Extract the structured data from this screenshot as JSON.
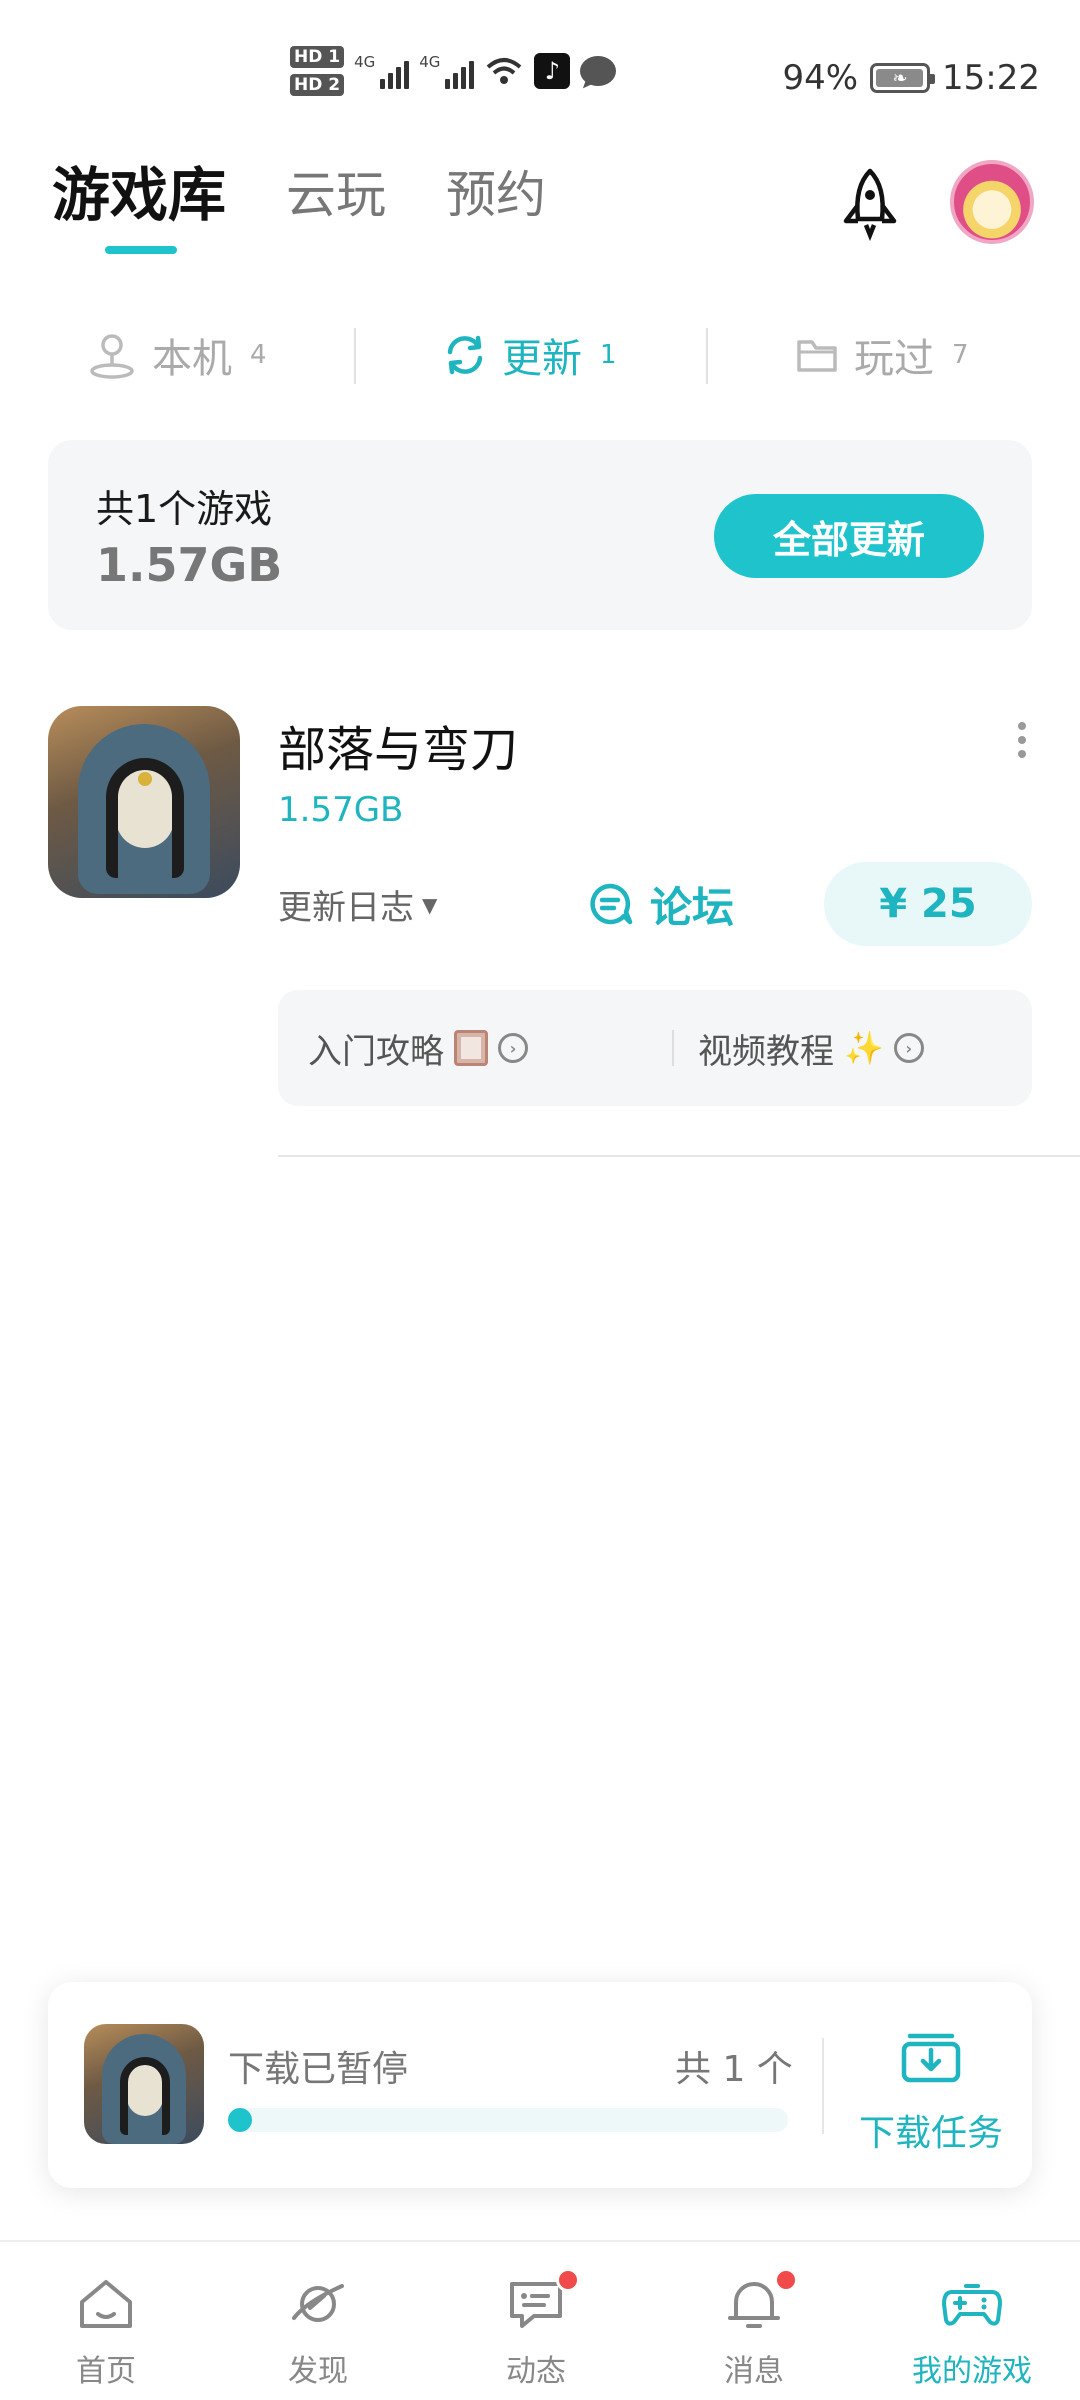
{
  "status_bar": {
    "hd1": "HD 1",
    "hd2": "HD 2",
    "signal_label": "4G",
    "battery": "94%",
    "time": "15:22",
    "icons": [
      "wifi-icon",
      "tiktok-icon",
      "chat-bubble-icon",
      "battery-icon"
    ]
  },
  "top_tabs": [
    {
      "label": "游戏库",
      "active": true
    },
    {
      "label": "云玩",
      "active": false
    },
    {
      "label": "预约",
      "active": false
    }
  ],
  "sub_tabs": [
    {
      "label": "本机",
      "count": "4",
      "icon": "local-device-icon"
    },
    {
      "label": "更新",
      "count": "1",
      "icon": "refresh-icon"
    },
    {
      "label": "玩过",
      "count": "7",
      "icon": "folder-icon"
    }
  ],
  "summary": {
    "count_text": "共1个游戏",
    "size_text": "1.57GB",
    "update_all_label": "全部更新"
  },
  "game": {
    "title": "部落与弯刀",
    "size": "1.57GB",
    "changelog_label": "更新日志",
    "forum_label": "论坛",
    "price_label": "¥ 25",
    "guide_label": "入门攻略",
    "video_label": "视频教程"
  },
  "download": {
    "status": "下载已暂停",
    "count_text": "共 1 个",
    "tasks_label": "下载任务",
    "progress_fraction": 0.02
  },
  "bottom_nav": [
    {
      "label": "首页",
      "icon": "home-icon",
      "active": false,
      "badge": false
    },
    {
      "label": "发现",
      "icon": "planet-icon",
      "active": false,
      "badge": false
    },
    {
      "label": "动态",
      "icon": "message-board-icon",
      "active": false,
      "badge": true
    },
    {
      "label": "消息",
      "icon": "bell-icon",
      "active": false,
      "badge": true
    },
    {
      "label": "我的游戏",
      "icon": "gamepad-icon",
      "active": true,
      "badge": false
    }
  ],
  "colors": {
    "accent": "#1fc3cc",
    "accent_text": "#1fb5c0",
    "badge_red": "#f04a4a"
  }
}
